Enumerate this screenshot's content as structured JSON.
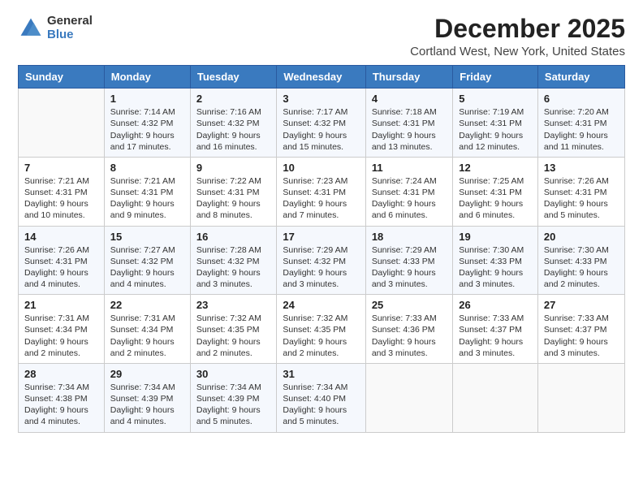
{
  "logo": {
    "general": "General",
    "blue": "Blue"
  },
  "title": "December 2025",
  "subtitle": "Cortland West, New York, United States",
  "weekdays": [
    "Sunday",
    "Monday",
    "Tuesday",
    "Wednesday",
    "Thursday",
    "Friday",
    "Saturday"
  ],
  "weeks": [
    [
      {
        "day": "",
        "info": ""
      },
      {
        "day": "1",
        "info": "Sunrise: 7:14 AM\nSunset: 4:32 PM\nDaylight: 9 hours\nand 17 minutes."
      },
      {
        "day": "2",
        "info": "Sunrise: 7:16 AM\nSunset: 4:32 PM\nDaylight: 9 hours\nand 16 minutes."
      },
      {
        "day": "3",
        "info": "Sunrise: 7:17 AM\nSunset: 4:32 PM\nDaylight: 9 hours\nand 15 minutes."
      },
      {
        "day": "4",
        "info": "Sunrise: 7:18 AM\nSunset: 4:31 PM\nDaylight: 9 hours\nand 13 minutes."
      },
      {
        "day": "5",
        "info": "Sunrise: 7:19 AM\nSunset: 4:31 PM\nDaylight: 9 hours\nand 12 minutes."
      },
      {
        "day": "6",
        "info": "Sunrise: 7:20 AM\nSunset: 4:31 PM\nDaylight: 9 hours\nand 11 minutes."
      }
    ],
    [
      {
        "day": "7",
        "info": "Sunrise: 7:21 AM\nSunset: 4:31 PM\nDaylight: 9 hours\nand 10 minutes."
      },
      {
        "day": "8",
        "info": "Sunrise: 7:21 AM\nSunset: 4:31 PM\nDaylight: 9 hours\nand 9 minutes."
      },
      {
        "day": "9",
        "info": "Sunrise: 7:22 AM\nSunset: 4:31 PM\nDaylight: 9 hours\nand 8 minutes."
      },
      {
        "day": "10",
        "info": "Sunrise: 7:23 AM\nSunset: 4:31 PM\nDaylight: 9 hours\nand 7 minutes."
      },
      {
        "day": "11",
        "info": "Sunrise: 7:24 AM\nSunset: 4:31 PM\nDaylight: 9 hours\nand 6 minutes."
      },
      {
        "day": "12",
        "info": "Sunrise: 7:25 AM\nSunset: 4:31 PM\nDaylight: 9 hours\nand 6 minutes."
      },
      {
        "day": "13",
        "info": "Sunrise: 7:26 AM\nSunset: 4:31 PM\nDaylight: 9 hours\nand 5 minutes."
      }
    ],
    [
      {
        "day": "14",
        "info": "Sunrise: 7:26 AM\nSunset: 4:31 PM\nDaylight: 9 hours\nand 4 minutes."
      },
      {
        "day": "15",
        "info": "Sunrise: 7:27 AM\nSunset: 4:32 PM\nDaylight: 9 hours\nand 4 minutes."
      },
      {
        "day": "16",
        "info": "Sunrise: 7:28 AM\nSunset: 4:32 PM\nDaylight: 9 hours\nand 3 minutes."
      },
      {
        "day": "17",
        "info": "Sunrise: 7:29 AM\nSunset: 4:32 PM\nDaylight: 9 hours\nand 3 minutes."
      },
      {
        "day": "18",
        "info": "Sunrise: 7:29 AM\nSunset: 4:33 PM\nDaylight: 9 hours\nand 3 minutes."
      },
      {
        "day": "19",
        "info": "Sunrise: 7:30 AM\nSunset: 4:33 PM\nDaylight: 9 hours\nand 3 minutes."
      },
      {
        "day": "20",
        "info": "Sunrise: 7:30 AM\nSunset: 4:33 PM\nDaylight: 9 hours\nand 2 minutes."
      }
    ],
    [
      {
        "day": "21",
        "info": "Sunrise: 7:31 AM\nSunset: 4:34 PM\nDaylight: 9 hours\nand 2 minutes."
      },
      {
        "day": "22",
        "info": "Sunrise: 7:31 AM\nSunset: 4:34 PM\nDaylight: 9 hours\nand 2 minutes."
      },
      {
        "day": "23",
        "info": "Sunrise: 7:32 AM\nSunset: 4:35 PM\nDaylight: 9 hours\nand 2 minutes."
      },
      {
        "day": "24",
        "info": "Sunrise: 7:32 AM\nSunset: 4:35 PM\nDaylight: 9 hours\nand 2 minutes."
      },
      {
        "day": "25",
        "info": "Sunrise: 7:33 AM\nSunset: 4:36 PM\nDaylight: 9 hours\nand 3 minutes."
      },
      {
        "day": "26",
        "info": "Sunrise: 7:33 AM\nSunset: 4:37 PM\nDaylight: 9 hours\nand 3 minutes."
      },
      {
        "day": "27",
        "info": "Sunrise: 7:33 AM\nSunset: 4:37 PM\nDaylight: 9 hours\nand 3 minutes."
      }
    ],
    [
      {
        "day": "28",
        "info": "Sunrise: 7:34 AM\nSunset: 4:38 PM\nDaylight: 9 hours\nand 4 minutes."
      },
      {
        "day": "29",
        "info": "Sunrise: 7:34 AM\nSunset: 4:39 PM\nDaylight: 9 hours\nand 4 minutes."
      },
      {
        "day": "30",
        "info": "Sunrise: 7:34 AM\nSunset: 4:39 PM\nDaylight: 9 hours\nand 5 minutes."
      },
      {
        "day": "31",
        "info": "Sunrise: 7:34 AM\nSunset: 4:40 PM\nDaylight: 9 hours\nand 5 minutes."
      },
      {
        "day": "",
        "info": ""
      },
      {
        "day": "",
        "info": ""
      },
      {
        "day": "",
        "info": ""
      }
    ]
  ]
}
